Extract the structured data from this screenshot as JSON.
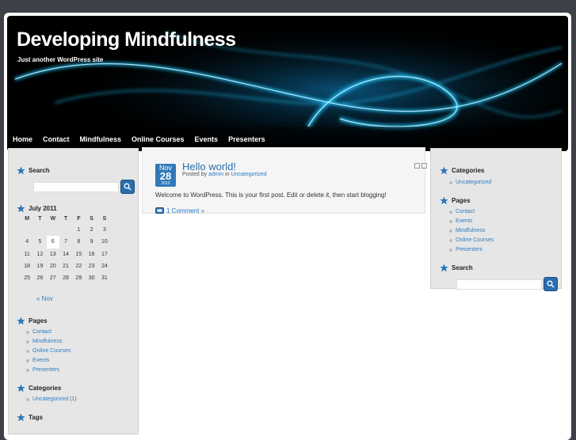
{
  "site": {
    "title": "Developing Mindfulness",
    "tagline": "Just another WordPress site"
  },
  "nav": [
    "Home",
    "Contact",
    "Mindfulness",
    "Online Courses",
    "Events",
    "Presenters"
  ],
  "left": {
    "search_title": "Search",
    "search_value": "",
    "calendar": {
      "caption": "July 2011",
      "days": [
        "M",
        "T",
        "W",
        "T",
        "F",
        "S",
        "S"
      ],
      "weeks": [
        [
          "",
          "",
          "",
          "",
          "1",
          "2",
          "3"
        ],
        [
          "4",
          "5",
          "6",
          "7",
          "8",
          "9",
          "10"
        ],
        [
          "11",
          "12",
          "13",
          "14",
          "15",
          "16",
          "17"
        ],
        [
          "18",
          "19",
          "20",
          "21",
          "22",
          "23",
          "24"
        ],
        [
          "25",
          "26",
          "27",
          "28",
          "29",
          "30",
          "31"
        ]
      ],
      "today": "6",
      "prev": "« Nov"
    },
    "pages_title": "Pages",
    "pages": [
      "Contact",
      "Mindfulness",
      "Online Courses",
      "Events",
      "Presenters"
    ],
    "categories_title": "Categories",
    "categories": [
      {
        "name": "Uncategorized",
        "count": "(1)"
      }
    ],
    "tags_title": "Tags"
  },
  "post": {
    "month": "Nov",
    "day": "28",
    "year": "2010",
    "title": "Hello world!",
    "meta_prefix": "Posted by",
    "author": "admin",
    "meta_in": "in",
    "category": "Uncategorized",
    "body": "Welcome to WordPress. This is your first post. Edit or delete it, then start blogging!",
    "comments": "1 Comment »"
  },
  "right": {
    "categories_title": "Categories",
    "categories": [
      "Uncategorized"
    ],
    "pages_title": "Pages",
    "pages": [
      "Contact",
      "Events",
      "Mindfulness",
      "Online Courses",
      "Presenters"
    ],
    "search_title": "Search",
    "search_value": ""
  },
  "colors": {
    "accent": "#2c7dc2",
    "header_bg": "#000000",
    "glow": "#1ec8ff",
    "page_bg": "#3d4046"
  }
}
